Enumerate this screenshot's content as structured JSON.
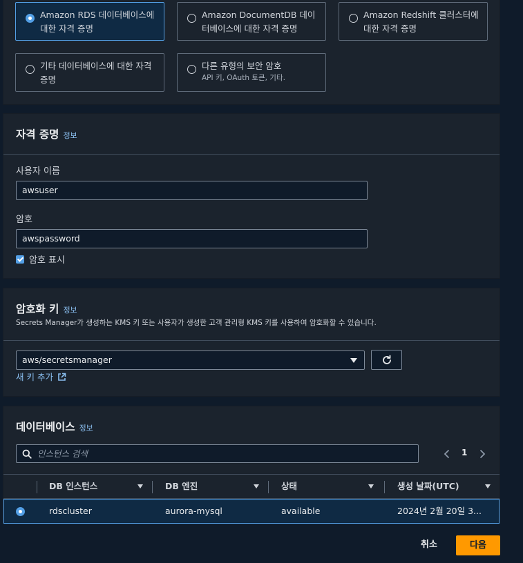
{
  "secret_type": {
    "options": [
      {
        "label": "Amazon RDS 데이터베이스에 대한 자격 증명",
        "sub": ""
      },
      {
        "label": "Amazon DocumentDB 데이터베이스에 대한 자격 증명",
        "sub": ""
      },
      {
        "label": "Amazon Redshift 클러스터에 대한 자격 증명",
        "sub": ""
      },
      {
        "label": "기타 데이터베이스에 대한 자격 증명",
        "sub": ""
      },
      {
        "label": "다른 유형의 보안 암호",
        "sub": "API 키, OAuth 토큰, 기타."
      }
    ],
    "selected_index": 0
  },
  "credentials": {
    "title": "자격 증명",
    "info": "정보",
    "username_label": "사용자 이름",
    "username_value": "awsuser",
    "password_label": "암호",
    "password_value": "awspassword",
    "show_password_label": "암호 표시",
    "show_password_checked": true
  },
  "encryption": {
    "title": "암호화 키",
    "info": "정보",
    "description": "Secrets Manager가 생성하는 KMS 키 또는 사용자가 생성한 고객 관리형 KMS 키를 사용하여 암호화할 수 있습니다.",
    "selected_key": "aws/secretsmanager",
    "add_key_link": "새 키 추가"
  },
  "database": {
    "title": "데이터베이스",
    "info": "정보",
    "search_placeholder": "인스턴스 검색",
    "page_number": "1",
    "columns": [
      "DB 인스턴스",
      "DB 엔진",
      "상태",
      "생성 날짜(UTC)"
    ],
    "rows": [
      {
        "instance": "rdscluster",
        "engine": "aurora-mysql",
        "status": "available",
        "created": "2024년 2월 20일 3...",
        "selected": true
      }
    ]
  },
  "actions": {
    "cancel": "취소",
    "next": "다음"
  },
  "colors": {
    "accent": "#539fe5",
    "primary_button": "#ff9900",
    "panel": "#1b232d",
    "background": "#0f1b2a"
  }
}
